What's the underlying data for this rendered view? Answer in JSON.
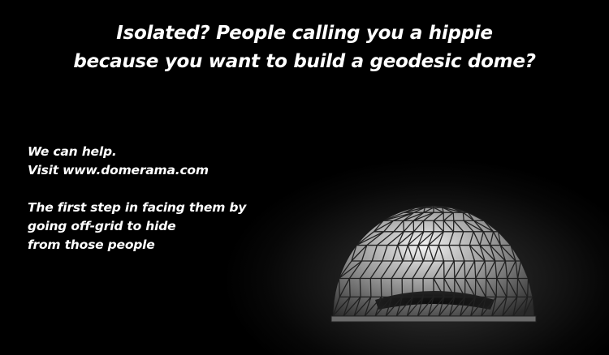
{
  "headline": {
    "line1": "Isolated? People calling you a hippie",
    "line2": "because you want to build a geodesic dome?"
  },
  "body": {
    "line1": "We can help.",
    "line2": "Visit www.domerama.com",
    "line3": "The first step in facing them by",
    "line4": "going off-grid to hide",
    "line5": "from those people"
  },
  "colors": {
    "background": "#000000",
    "text": "#ffffff",
    "glow": "#3a3a3a"
  },
  "illustration": "geodesic-dome"
}
